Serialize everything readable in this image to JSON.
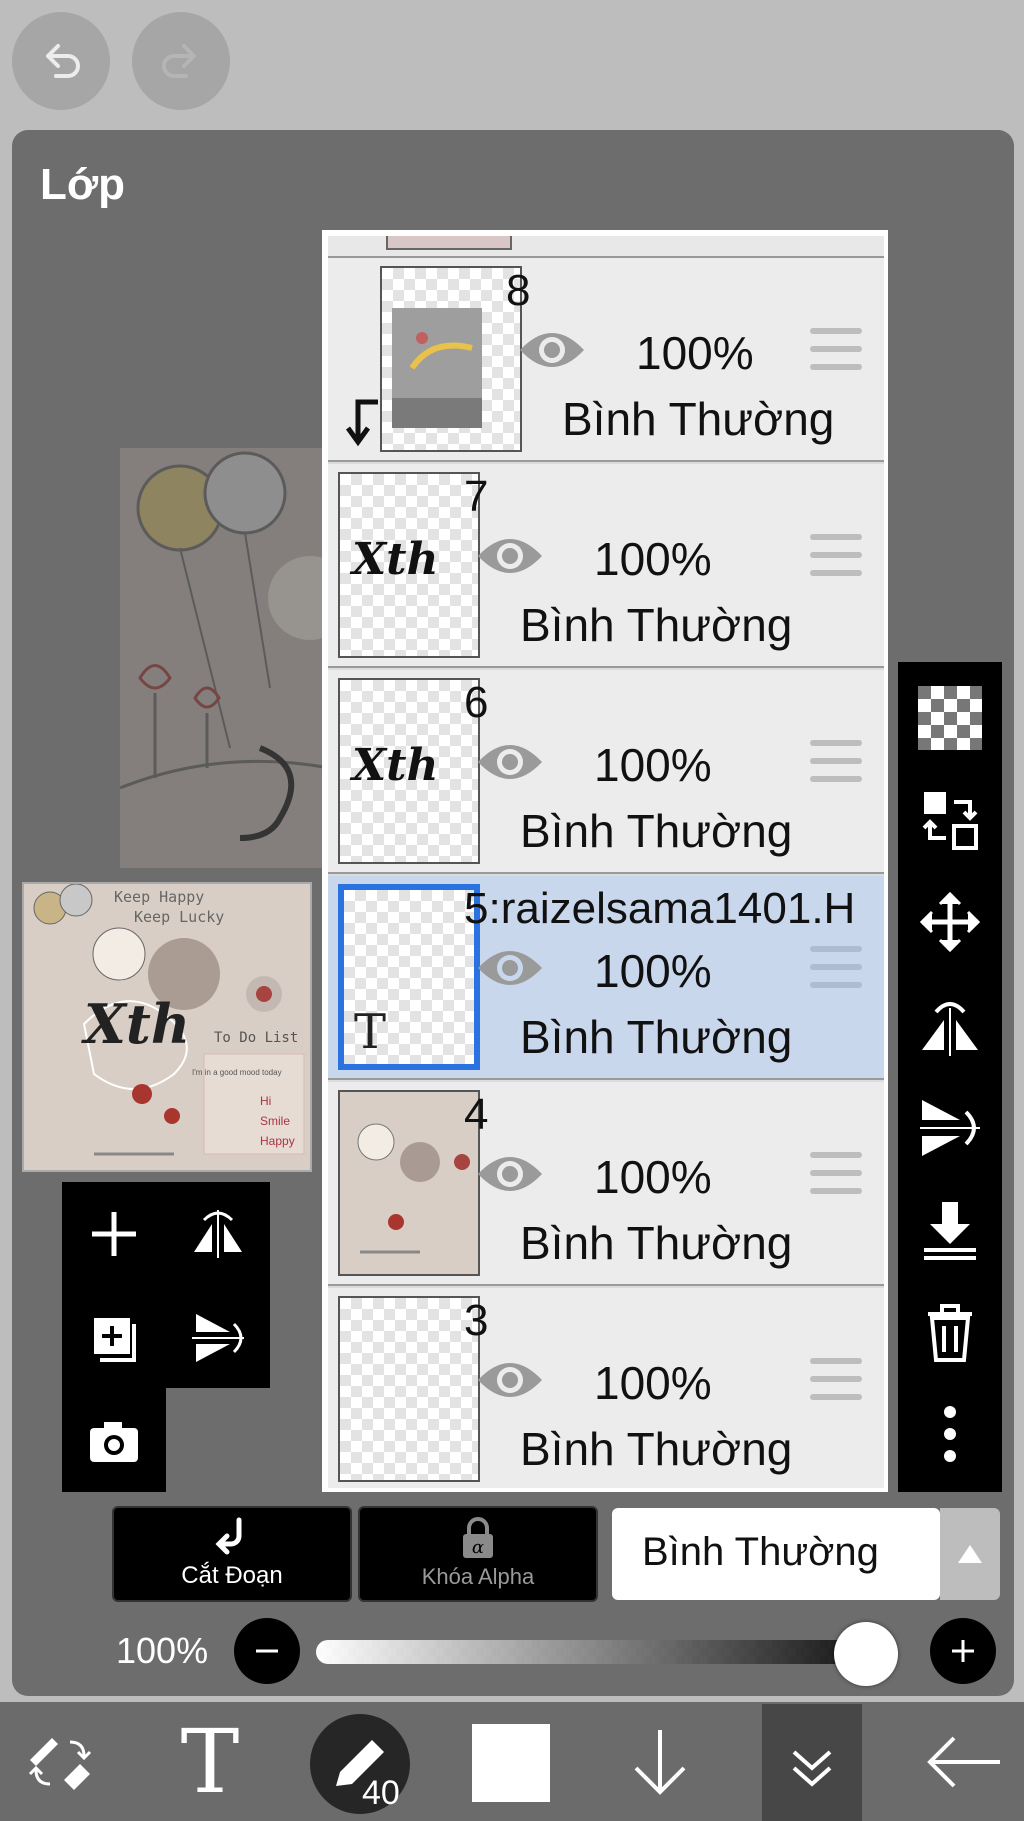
{
  "header": {
    "undo_icon": "undo-arrow-icon",
    "redo_icon": "redo-arrow-icon"
  },
  "panel": {
    "title": "Lớp"
  },
  "layers": [
    {
      "name": "8",
      "opacity": "100%",
      "blend": "Bình Thường",
      "clipped": true,
      "selected": false
    },
    {
      "name": "7",
      "opacity": "100%",
      "blend": "Bình Thường",
      "clipped": false,
      "selected": false
    },
    {
      "name": "6",
      "opacity": "100%",
      "blend": "Bình Thường",
      "clipped": false,
      "selected": false
    },
    {
      "name": "5:raizelsama1401.H",
      "opacity": "100%",
      "blend": "Bình Thường",
      "clipped": false,
      "selected": true,
      "text_layer_mark": "T"
    },
    {
      "name": "4",
      "opacity": "100%",
      "blend": "Bình Thường",
      "clipped": false,
      "selected": false
    },
    {
      "name": "3",
      "opacity": "100%",
      "blend": "Bình Thường",
      "clipped": false,
      "selected": false
    }
  ],
  "thumb_text": {
    "line1": "Keep Happy",
    "line2": "Keep Lucky",
    "signature": "Xth",
    "todo": "To Do List",
    "mood": "I'm in a good mood today",
    "item1": "Hi",
    "item2": "Smile",
    "item3": "Happy"
  },
  "controls": {
    "clip_label": "Cắt Đoạn",
    "alpha_lock_label": "Khóa Alpha",
    "blend_mode_value": "Bình Thường",
    "opacity_label": "100%",
    "opacity_value": 1.0
  },
  "bottom_bar": {
    "brush_size": "40"
  },
  "colors": {
    "panel_bg": "#6d6d6d",
    "selected_row": "#c9d7ec",
    "selected_border": "#2a72e0",
    "primary_color": "#ffffff"
  }
}
